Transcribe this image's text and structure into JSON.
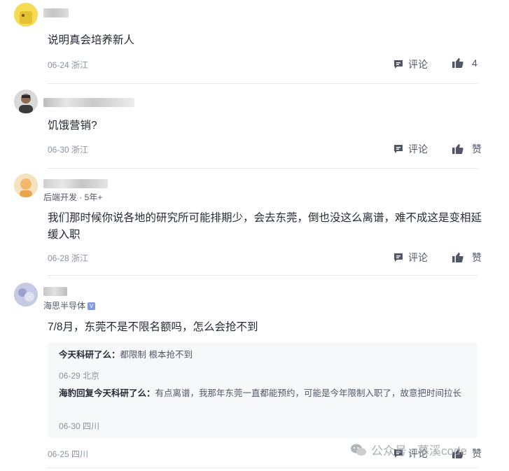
{
  "comments": [
    {
      "text": "说明真会培养新人",
      "date": "06-24",
      "location": "浙江",
      "reply_label": "评论",
      "like_label": "4"
    },
    {
      "text": "饥饿营销?",
      "date": "06-30",
      "location": "浙江",
      "reply_label": "评论",
      "like_label": "赞"
    },
    {
      "subtitle": "后端开发 · 5年+",
      "text": "我们那时候你说各地的研究所可能排期少，会去东莞，倒也没这么离谱，难不成这是变相延缓入职",
      "date": "06-28",
      "location": "浙江",
      "reply_label": "评论",
      "like_label": "赞"
    },
    {
      "subtitle": "海思半导体",
      "badge": "V",
      "text": "7/8月，东莞不是不限名额吗，怎么会抢不到",
      "date": "06-25",
      "location": "四川",
      "reply_label": "评论",
      "like_label": "赞",
      "replies": [
        {
          "author": "今天科研了么",
          "sep": "：",
          "content": "都限制 根本抢不到",
          "date": "06-29",
          "location": "北京"
        },
        {
          "author": "海豹回复今天科研了么",
          "sep": "：",
          "content": "有点离谱，我那年东莞一直都能预约，可能是今年限制入职了，故意把时间拉长",
          "date": "06-30",
          "location": "四川"
        }
      ]
    }
  ],
  "watermark": "公众号 · 慕溪code",
  "icons": {
    "comment": "comment-icon",
    "like": "thumbs-up-icon",
    "watermark": "wechat-icon",
    "verified": "verified-badge-icon"
  },
  "colors": {
    "text": "#252933",
    "meta": "#8a919f",
    "reply_bg": "#f7f8fa",
    "badge": "#7b9ae8"
  }
}
